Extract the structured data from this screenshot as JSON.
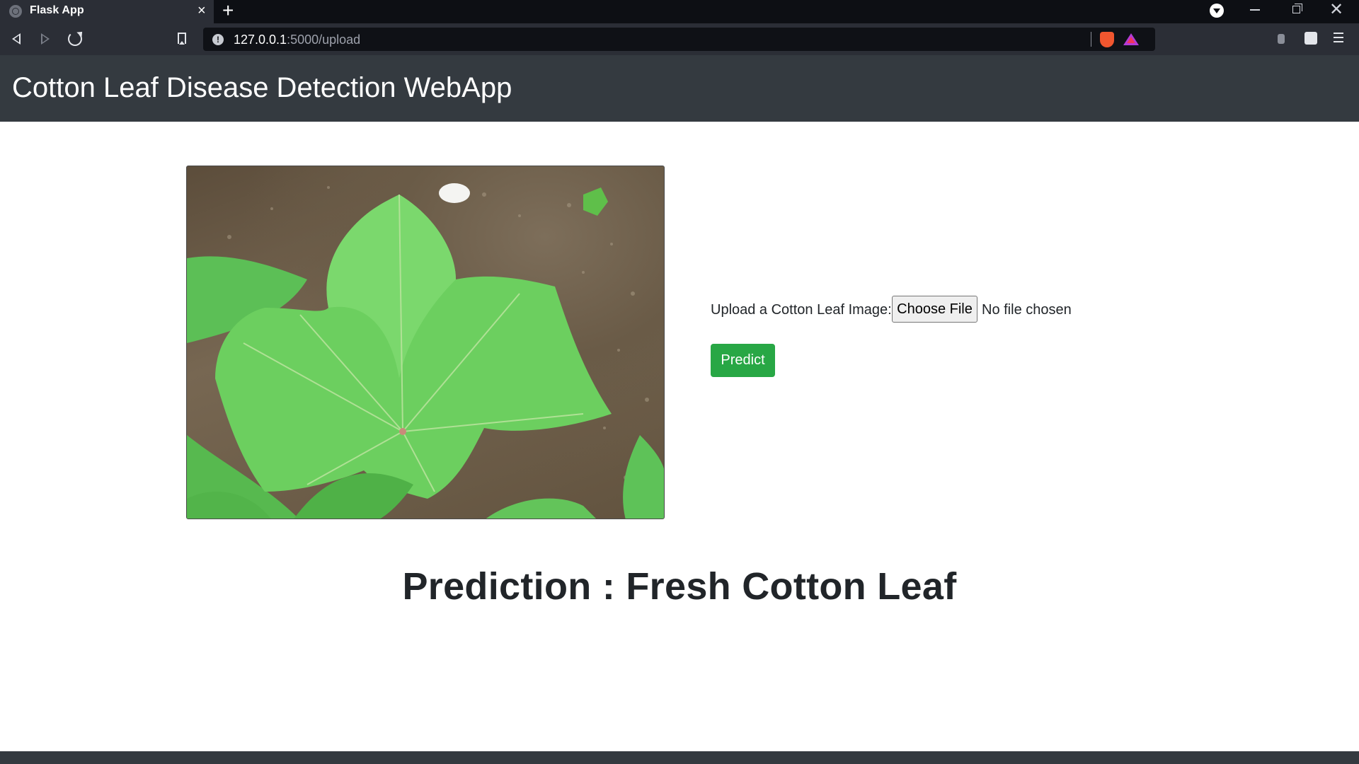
{
  "browser": {
    "tab": {
      "title": "Flask App",
      "close": "×"
    },
    "new_tab": "+",
    "window": {
      "close": "✕"
    },
    "address": {
      "host": "127.0.0.1",
      "path": ":5000/upload"
    },
    "info_icon": "!"
  },
  "app": {
    "title": "Cotton Leaf Disease Detection WebApp"
  },
  "upload": {
    "label": "Upload a Cotton Leaf Image:",
    "button": "Choose File",
    "status": "No file chosen"
  },
  "predict_button": "Predict",
  "prediction": "Prediction : Fresh Cotton Leaf",
  "colors": {
    "navbar": "#343a40",
    "predict": "#28a745"
  },
  "icons": [
    "back-icon",
    "forward-icon",
    "reload-icon",
    "bookmark-icon",
    "info-icon",
    "brave-shield-icon",
    "brave-rewards-icon",
    "extensions-icon",
    "menu-icon",
    "media-icon"
  ]
}
